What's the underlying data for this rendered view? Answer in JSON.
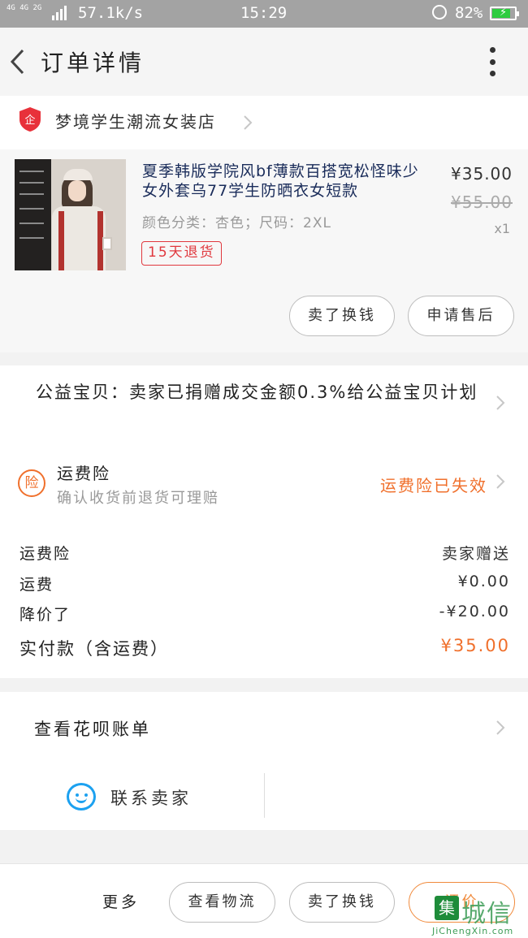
{
  "status_bar": {
    "signal": "4G 4G 2G",
    "speed": "57.1k/s",
    "time": "15:29",
    "battery": "82%",
    "battery_level": 0.82
  },
  "header": {
    "title": "订单详情"
  },
  "shop": {
    "badge": "企",
    "name": "梦境学生潮流女装店"
  },
  "item": {
    "title": "夏季韩版学院风bf薄款百搭宽松怪味少女外套乌77学生防晒衣女短款",
    "attributes": "颜色分类：杏色；尺码：2XL",
    "badge": "15天退货",
    "price": "¥35.00",
    "original_price": "¥55.00",
    "quantity": "x1",
    "actions": [
      "卖了换钱",
      "申请售后"
    ]
  },
  "charity": {
    "text": "公益宝贝：卖家已捐赠成交金额0.3%给公益宝贝计划"
  },
  "insurance": {
    "icon_label": "险",
    "title": "运费险",
    "subtitle": "确认收货前退货可理赔",
    "status": "运费险已失效"
  },
  "fees": [
    {
      "label": "运费险",
      "value": "卖家赠送"
    },
    {
      "label": "运费",
      "value": "¥0.00"
    },
    {
      "label": "降价了",
      "value": "-¥20.00"
    },
    {
      "label": "实付款（含运费）",
      "value": "¥35.00"
    }
  ],
  "bill": {
    "label": "查看花呗账单"
  },
  "contact": {
    "label": "联系卖家"
  },
  "footer": {
    "more": "更多",
    "buttons": [
      "查看物流",
      "卖了换钱",
      "评价"
    ]
  },
  "watermark": {
    "logo": "集",
    "name": "城信",
    "url": "JiChengXin.com"
  },
  "colors": {
    "accent": "#f0702c",
    "danger": "#e0383e",
    "link": "#1ca1f0",
    "title_text": "#1a2c5a"
  }
}
